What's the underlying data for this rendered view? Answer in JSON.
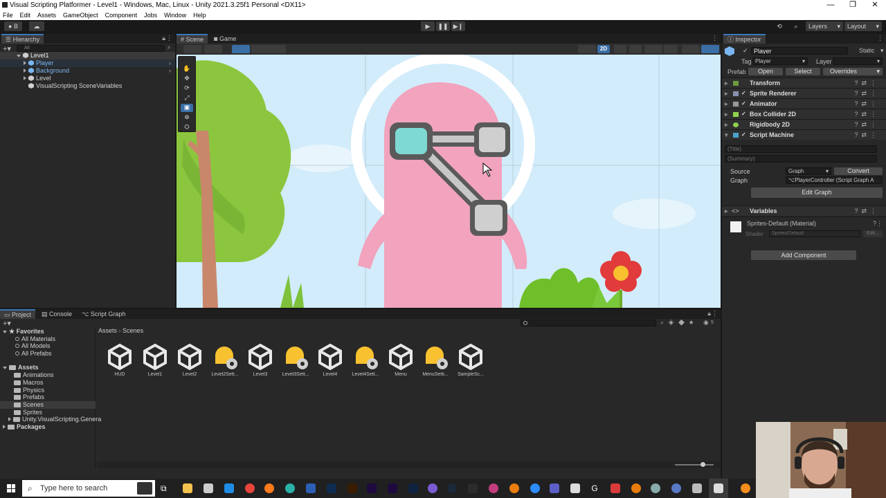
{
  "window": {
    "title": "Visual Scripting Platformer - Level1 - Windows, Mac, Linux - Unity 2021.3.25f1 Personal <DX11>",
    "controls": [
      "—",
      "❐",
      "✕"
    ]
  },
  "menu": [
    "File",
    "Edit",
    "Assets",
    "GameObject",
    "Component",
    "Jobs",
    "Window",
    "Help"
  ],
  "toolbar": {
    "account": "B",
    "layers": "Layers",
    "layout": "Layout"
  },
  "hierarchy": {
    "tab": "Hierarchy",
    "search_placeholder": "All",
    "scene": "Level1",
    "items": [
      "Player",
      "Background",
      "Level",
      "VisualScripting SceneVariables"
    ]
  },
  "scene_view": {
    "tabs": [
      "Scene",
      "Game"
    ],
    "mode_2d": "2D"
  },
  "inspector": {
    "tab": "Inspector",
    "object_name": "Player",
    "static_label": "Static",
    "tag_label": "Tag",
    "tag_value": "Player",
    "layer_label": "Layer",
    "layer_value": "",
    "prefab_label": "Prefab",
    "prefab_open": "Open",
    "prefab_select": "Select",
    "prefab_overrides": "Overrides",
    "components": [
      "Transform",
      "Sprite Renderer",
      "Animator",
      "Box Collider 2D",
      "Rigidbody 2D",
      "Script Machine"
    ],
    "title_placeholder": "(Title)",
    "summary_placeholder": "(Summary)",
    "source_label": "Source",
    "source_value": "Graph",
    "convert_button": "Convert",
    "graph_label": "Graph",
    "graph_value": "PlayerController (Script Graph A",
    "edit_graph_button": "Edit Graph",
    "variables_label": "Variables",
    "material_name": "Sprites-Default (Material)",
    "shader_label": "Shader",
    "shader_value": "Sprites/Default",
    "shader_edit": "Edit...",
    "add_component": "Add Component"
  },
  "project": {
    "tabs": [
      "Project",
      "Console",
      "Script Graph"
    ],
    "favorites_label": "Favorites",
    "favorites": [
      "All Materials",
      "All Models",
      "All Prefabs"
    ],
    "assets_label": "Assets",
    "asset_folders": [
      "Animations",
      "Macros",
      "Physics",
      "Prefabs",
      "Scenes",
      "Sprites",
      "Unity.VisualScripting.Genera"
    ],
    "packages_label": "Packages",
    "breadcrumb": [
      "Assets",
      "Scenes"
    ],
    "badge_count": "5",
    "files": [
      {
        "name": "HUD",
        "kind": "scene"
      },
      {
        "name": "Level1",
        "kind": "scene"
      },
      {
        "name": "Level2",
        "kind": "scene"
      },
      {
        "name": "Level2Sett...",
        "kind": "settings"
      },
      {
        "name": "Level3",
        "kind": "scene"
      },
      {
        "name": "Level3Sett...",
        "kind": "settings"
      },
      {
        "name": "Level4",
        "kind": "scene"
      },
      {
        "name": "Level4Sett...",
        "kind": "settings"
      },
      {
        "name": "Menu",
        "kind": "scene"
      },
      {
        "name": "MenuSetti...",
        "kind": "settings"
      },
      {
        "name": "SampleSc...",
        "kind": "scene"
      }
    ]
  },
  "taskbar": {
    "search_placeholder": "Type here to search"
  },
  "colors": {
    "accent": "#3a79bb",
    "sky": "#cfe9f9",
    "character": "#f2a3bd",
    "tree": "#8cc63f"
  }
}
